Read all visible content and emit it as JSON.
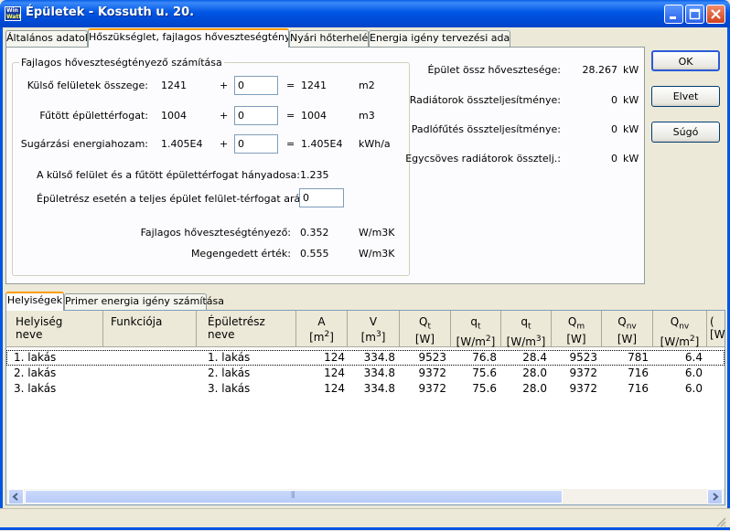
{
  "window": {
    "title": "Épületek - Kossuth u. 20.",
    "icon_top": "Win",
    "icon_bottom": "Watt"
  },
  "tabs": [
    {
      "label": "Általános adatok"
    },
    {
      "label": "Hőszükséglet, fajlagos hőveszteségtényező"
    },
    {
      "label": "Nyári hőterhelés"
    },
    {
      "label": "Energia igény tervezési adatok"
    }
  ],
  "group": {
    "title": "Fajlagos hőveszteségtényező számítása",
    "rows": [
      {
        "label": "Külső felületek összege:",
        "value": "1241",
        "plus": "+",
        "input": "0",
        "eq": "=",
        "result": "1241",
        "unit": "m2"
      },
      {
        "label": "Fűtött épülettérfogat:",
        "value": "1004",
        "plus": "+",
        "input": "0",
        "eq": "=",
        "result": "1004",
        "unit": "m3"
      },
      {
        "label": "Sugárzási energiahozam:",
        "value": "1.405E4",
        "plus": "+",
        "input": "0",
        "eq": "=",
        "result": "1.405E4",
        "unit": "kWh/a"
      }
    ],
    "ratio_label": "A külső felület és a fűtött épülettérfogat hányadosa:",
    "ratio_value": "1.235",
    "part_label": "Épületrész esetén a teljes épület felület-térfogat aránya:",
    "part_input": "0",
    "specific_label": "Fajlagos hőveszteségtényező:",
    "specific_value": "0.352",
    "specific_unit": "W/m3K",
    "allowed_label": "Megengedett érték:",
    "allowed_value": "0.555",
    "allowed_unit": "W/m3K"
  },
  "summary": [
    {
      "label": "Épület össz hővesztesége:",
      "value": "28.267",
      "unit": "kW"
    },
    {
      "label": "Radiátorok összteljesítménye:",
      "value": "0",
      "unit": "kW"
    },
    {
      "label": "Padlófűtés összteljesítménye:",
      "value": "0",
      "unit": "kW"
    },
    {
      "label": "Egycsöves radiátorok össztelj.:",
      "value": "0",
      "unit": "kW"
    }
  ],
  "buttons": {
    "ok": "OK",
    "cancel": "Elvet",
    "help": "Súgó"
  },
  "lower_tabs": [
    {
      "label": "Helyiségek"
    },
    {
      "label": "Primer energia igény számítása"
    }
  ],
  "table": {
    "headers": [
      {
        "l1": "Helyiség",
        "l2": "neve"
      },
      {
        "l1": "Funkciója",
        "l2": ""
      },
      {
        "l1": "Épületrész",
        "l2": "neve"
      },
      {
        "l1": "A",
        "l2": "[m",
        "sup": "2",
        "end": "]"
      },
      {
        "l1": "V",
        "l2": "[m",
        "sup": "3",
        "end": "]"
      },
      {
        "l1": "Q",
        "sub1": "t",
        "l2": "[W]"
      },
      {
        "l1": "q",
        "sub1": "t",
        "l2": "[W/m",
        "sup": "2",
        "end": "]"
      },
      {
        "l1": "q",
        "sub1": "t",
        "l2": "[W/m",
        "sup": "3",
        "end": "]"
      },
      {
        "l1": "Q",
        "sub1": "m",
        "l2": "[W]"
      },
      {
        "l1": "Q",
        "sub1": "nv",
        "l2": "[W]"
      },
      {
        "l1": "Q",
        "sub1": "nv",
        "l2": "[W/m",
        "sup": "2",
        "end": "]"
      },
      {
        "l1": "(",
        "l2": "[W"
      }
    ],
    "rows": [
      [
        "1. lakás",
        "",
        "1. lakás",
        "124",
        "334.8",
        "9523",
        "76.8",
        "28.4",
        "9523",
        "781",
        "6.4"
      ],
      [
        "2. lakás",
        "",
        "2. lakás",
        "124",
        "334.8",
        "9372",
        "75.6",
        "28.0",
        "9372",
        "716",
        "6.0"
      ],
      [
        "3. lakás",
        "",
        "3. lakás",
        "124",
        "334.8",
        "9372",
        "75.6",
        "28.0",
        "9372",
        "716",
        "6.0"
      ]
    ]
  },
  "scrollbar": {
    "thumb_grip": "⦀"
  }
}
